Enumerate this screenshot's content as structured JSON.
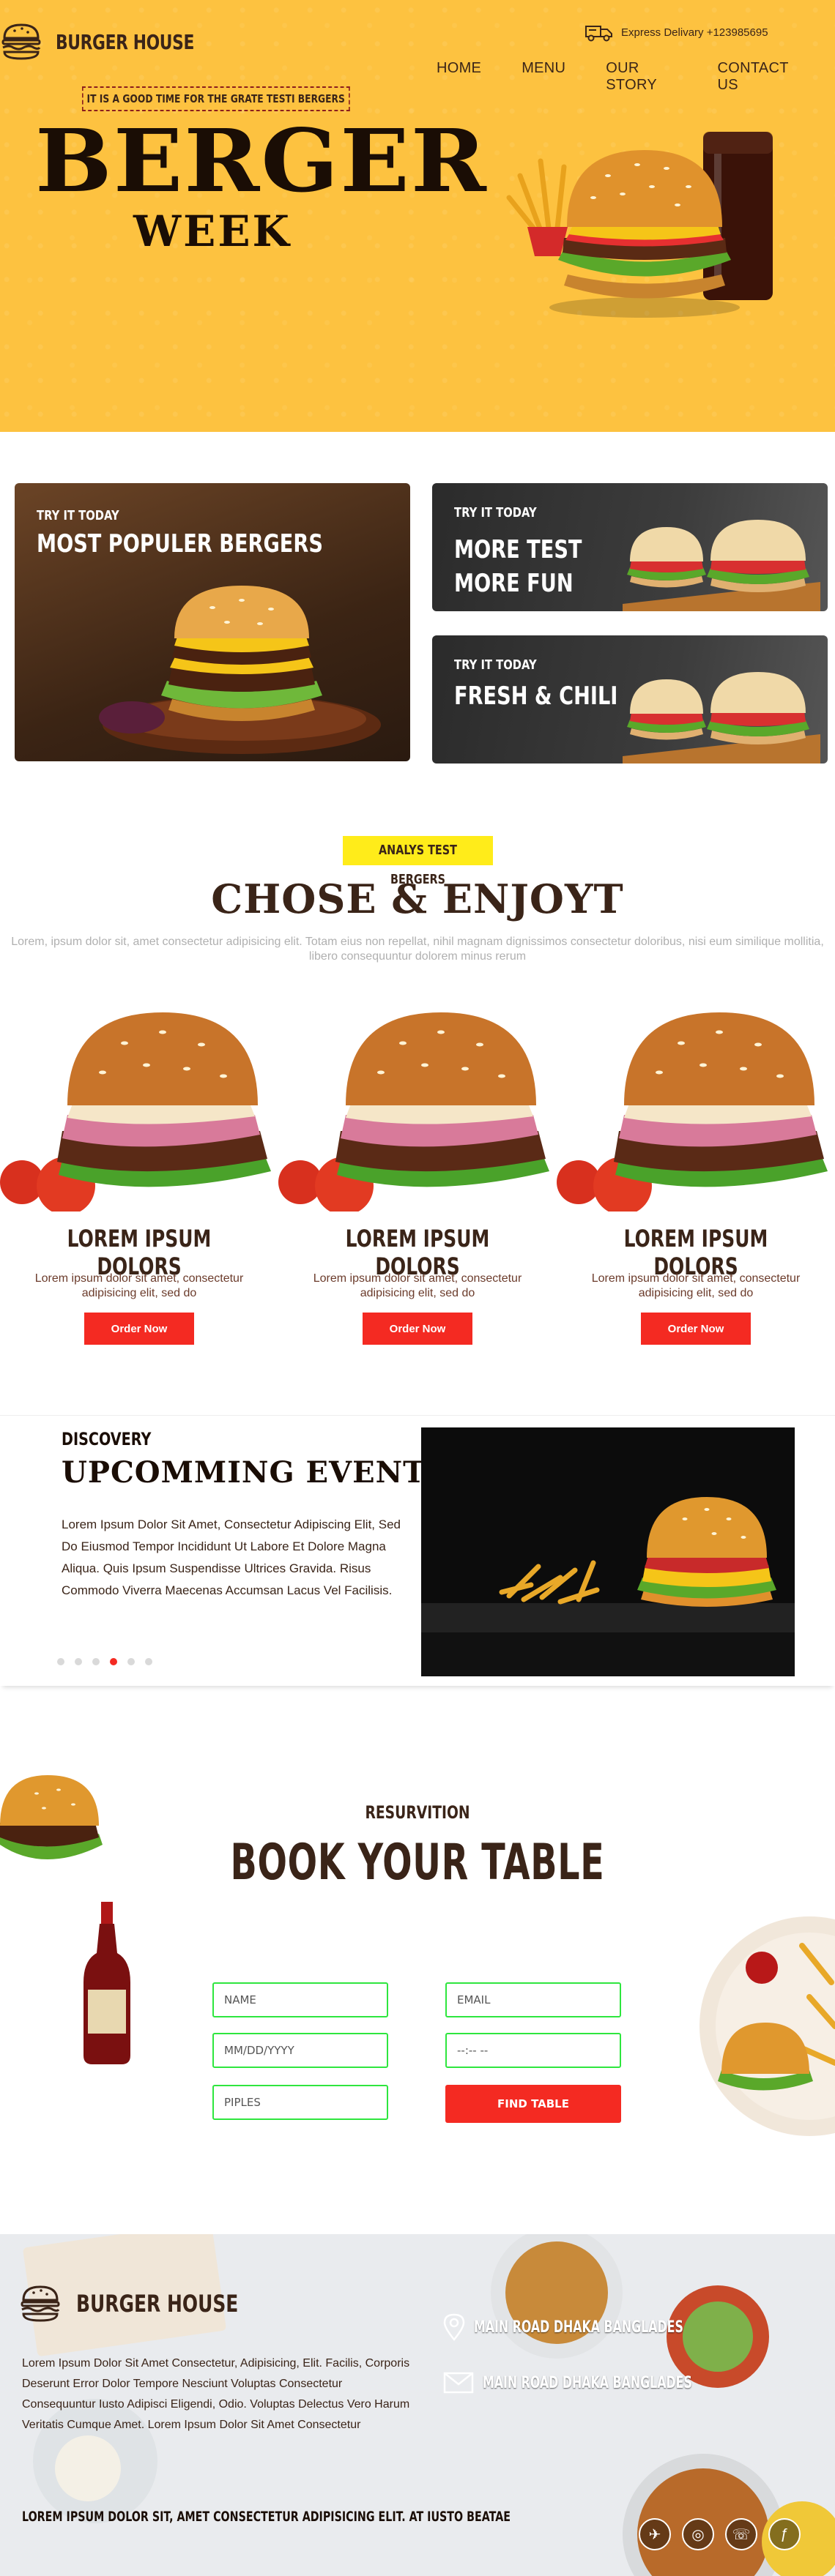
{
  "header": {
    "brand": "BURGER HOUSE",
    "delivery": "Express Delivary +123985695",
    "nav": [
      "HOME",
      "MENU",
      "OUR STORY",
      "CONTACT US"
    ]
  },
  "hero": {
    "tagline": "IT IS A GOOD TIME FOR THE GRATE TESTI BERGERS",
    "title": "BERGER",
    "subtitle": "WEEK"
  },
  "features": [
    {
      "kicker": "TRY IT TODAY",
      "heading": "MOST POPULER BERGERS"
    },
    {
      "kicker": "TRY IT TODAY",
      "heading_lines": [
        "MORE TEST",
        "MORE FUN"
      ]
    },
    {
      "kicker": "TRY IT TODAY",
      "heading": "FRESH & CHILI"
    }
  ],
  "menu": {
    "badge": "ANALYS TEST BERGERS",
    "title": "CHOSE & ENJOYT",
    "lead": "Lorem, ipsum dolor sit, amet consectetur adipisicing elit. Totam eius non repellat, nihil magnam dignissimos consectetur doloribus, nisi eum similique mollitia, libero consequuntur dolorem minus rerum",
    "items": [
      {
        "name": "LOREM IPSUM DOLORS",
        "desc": "Lorem ipsum dolor sit amet, consectetur adipisicing elit, sed do",
        "button": "Order Now"
      },
      {
        "name": "LOREM IPSUM DOLORS",
        "desc": "Lorem ipsum dolor sit amet, consectetur adipisicing elit, sed do",
        "button": "Order Now"
      },
      {
        "name": "LOREM IPSUM DOLORS",
        "desc": "Lorem ipsum dolor sit amet, consectetur adipisicing elit, sed do",
        "button": "Order Now"
      }
    ]
  },
  "events": {
    "kicker": "DISCOVERY",
    "title": "UPCOMMING EVENTS",
    "text": "Lorem Ipsum Dolor Sit Amet, Consectetur Adipiscing Elit, Sed Do Eiusmod Tempor Incididunt Ut Labore Et Dolore Magna Aliqua. Quis Ipsum Suspendisse Ultrices Gravida. Risus Commodo Viverra Maecenas Accumsan Lacus Vel Facilisis.",
    "slide_count": 6,
    "active_slide": 4
  },
  "reservation": {
    "kicker": "RESURVITION",
    "title": "BOOK YOUR TABLE",
    "name_placeholder": "NAME",
    "email_placeholder": "EMAIL",
    "date_placeholder": "MM/DD/YYYY",
    "time_placeholder": "--:-- --",
    "people_placeholder": "PIPLES",
    "button": "FIND TABLE"
  },
  "footer": {
    "brand": "BURGER HOUSE",
    "text": "Lorem Ipsum Dolor Sit Amet Consectetur, Adipisicing, Elit. Facilis, Corporis Deserunt Error Dolor Tempore Nesciunt Voluptas Consectetur Consequuntur Iusto Adipisci Eligendi, Odio. Voluptas Delectus Vero Harum Veritatis Cumque Amet. Lorem Ipsum Dolor Sit Amet Consectetur",
    "address": "MAIN ROAD DHAKA BANGLADES",
    "mail": "MAIN ROAD DHAKA BANGLADES",
    "copyright": "LOREM IPSUM DOLOR SIT, AMET CONSECTETUR ADIPISICING ELIT. AT IUSTO BEATAE"
  },
  "colors": {
    "hero_bg": "#fdc240",
    "accent_red": "#f42a22",
    "badge_yellow": "#ffec1a",
    "field_border": "#2ee63e",
    "text_brown": "#3a2418"
  },
  "icons": [
    "burger-logo-icon",
    "delivery-truck-icon",
    "location-pin-icon",
    "mail-icon",
    "social-icons"
  ]
}
